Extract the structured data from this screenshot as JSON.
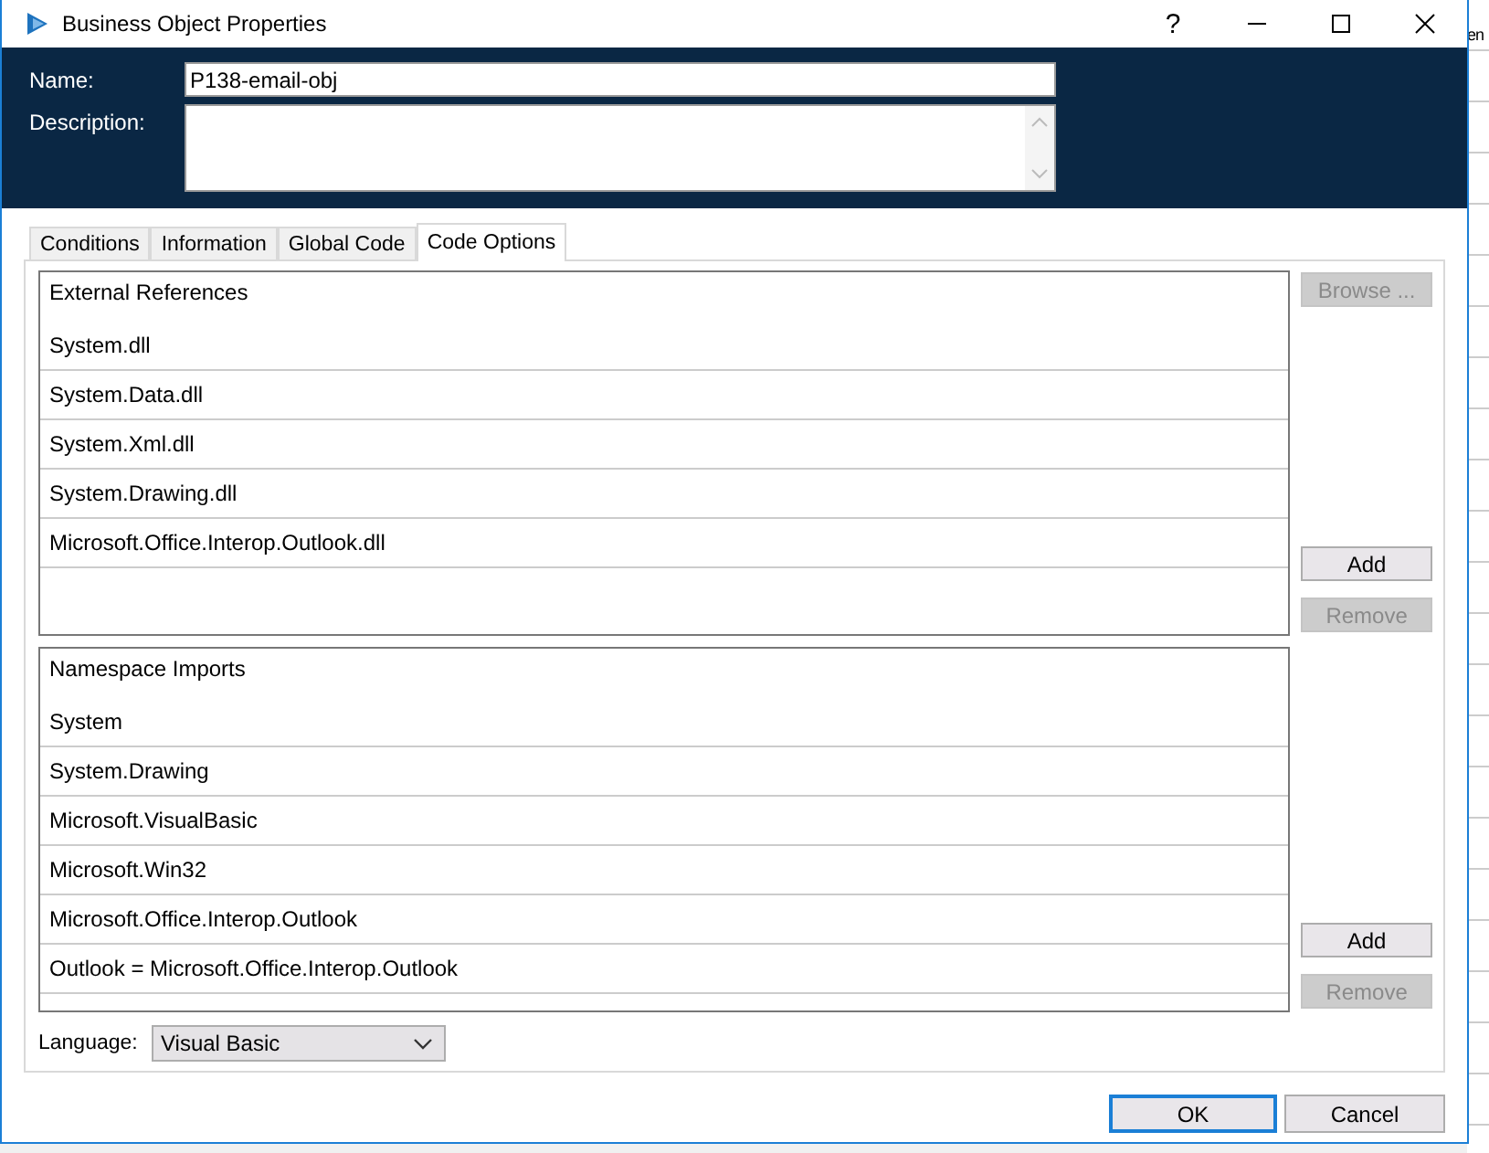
{
  "window": {
    "title": "Business Object Properties",
    "controls": [
      "?"
    ]
  },
  "background_app": {
    "text": "en"
  },
  "header": {
    "name_label": "Name:",
    "name_value": "P138-email-obj",
    "description_label": "Description:"
  },
  "tabs": [
    {
      "label": "Conditions",
      "selected": false
    },
    {
      "label": "Information",
      "selected": false
    },
    {
      "label": "Global Code",
      "selected": false
    },
    {
      "label": "Code Options",
      "selected": true
    }
  ],
  "external_references": {
    "heading": "External References",
    "items": [
      "System.dll",
      "System.Data.dll",
      "System.Xml.dll",
      "System.Drawing.dll",
      "Microsoft.Office.Interop.Outlook.dll"
    ],
    "buttons": [
      {
        "label": "Browse ...",
        "disabled": true,
        "kind": "top"
      },
      {
        "label": "Add",
        "disabled": false,
        "kind": "bottom"
      },
      {
        "label": "Remove",
        "disabled": true,
        "kind": "bottom"
      }
    ]
  },
  "namespace_imports": {
    "heading": "Namespace Imports",
    "items": [
      "System",
      "System.Drawing",
      "Microsoft.VisualBasic",
      "Microsoft.Win32",
      "Microsoft.Office.Interop.Outlook",
      "Outlook = Microsoft.Office.Interop.Outlook"
    ],
    "buttons": [
      {
        "label": "Add",
        "disabled": false,
        "kind": "bottom"
      },
      {
        "label": "Remove",
        "disabled": true,
        "kind": "bottom"
      }
    ]
  },
  "language": {
    "label": "Language:",
    "value": "Visual Basic"
  },
  "buttons": [
    {
      "label": "OK",
      "selected": true
    },
    {
      "label": "Cancel",
      "selected": false
    }
  ]
}
